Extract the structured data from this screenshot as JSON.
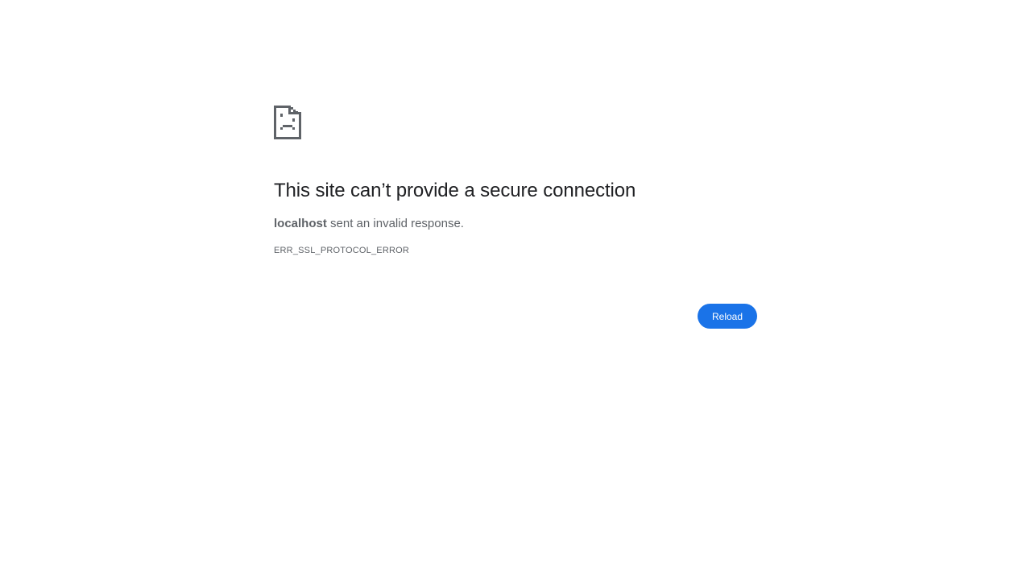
{
  "error": {
    "icon": "sad-document-icon",
    "title": "This site can’t provide a secure connection",
    "host": "localhost",
    "message": " sent an invalid response.",
    "code": "ERR_SSL_PROTOCOL_ERROR"
  },
  "actions": {
    "reload_label": "Reload"
  },
  "colors": {
    "accent": "#1a73e8",
    "title_text": "#202124",
    "secondary_text": "#5f6368",
    "icon": "#5f6368"
  }
}
